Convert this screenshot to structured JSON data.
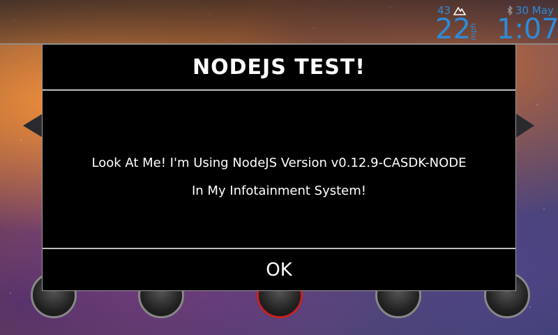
{
  "status_bar": {
    "speed_limit": "43",
    "speed": "22",
    "speed_unit": "mph",
    "date": "30 May",
    "time": "1:07",
    "accent_color": "#2d8bd9"
  },
  "dialog": {
    "title": "NODEJS TEST!",
    "message_line1": "Look At Me! I'm Using NodeJS Version v0.12.9-CASDK-NODE",
    "message_line2": "In My Infotainment System!",
    "ok_label": "OK"
  },
  "icons": {
    "speed_limit": "mountain-icon",
    "bluetooth": "bluetooth-icon"
  }
}
